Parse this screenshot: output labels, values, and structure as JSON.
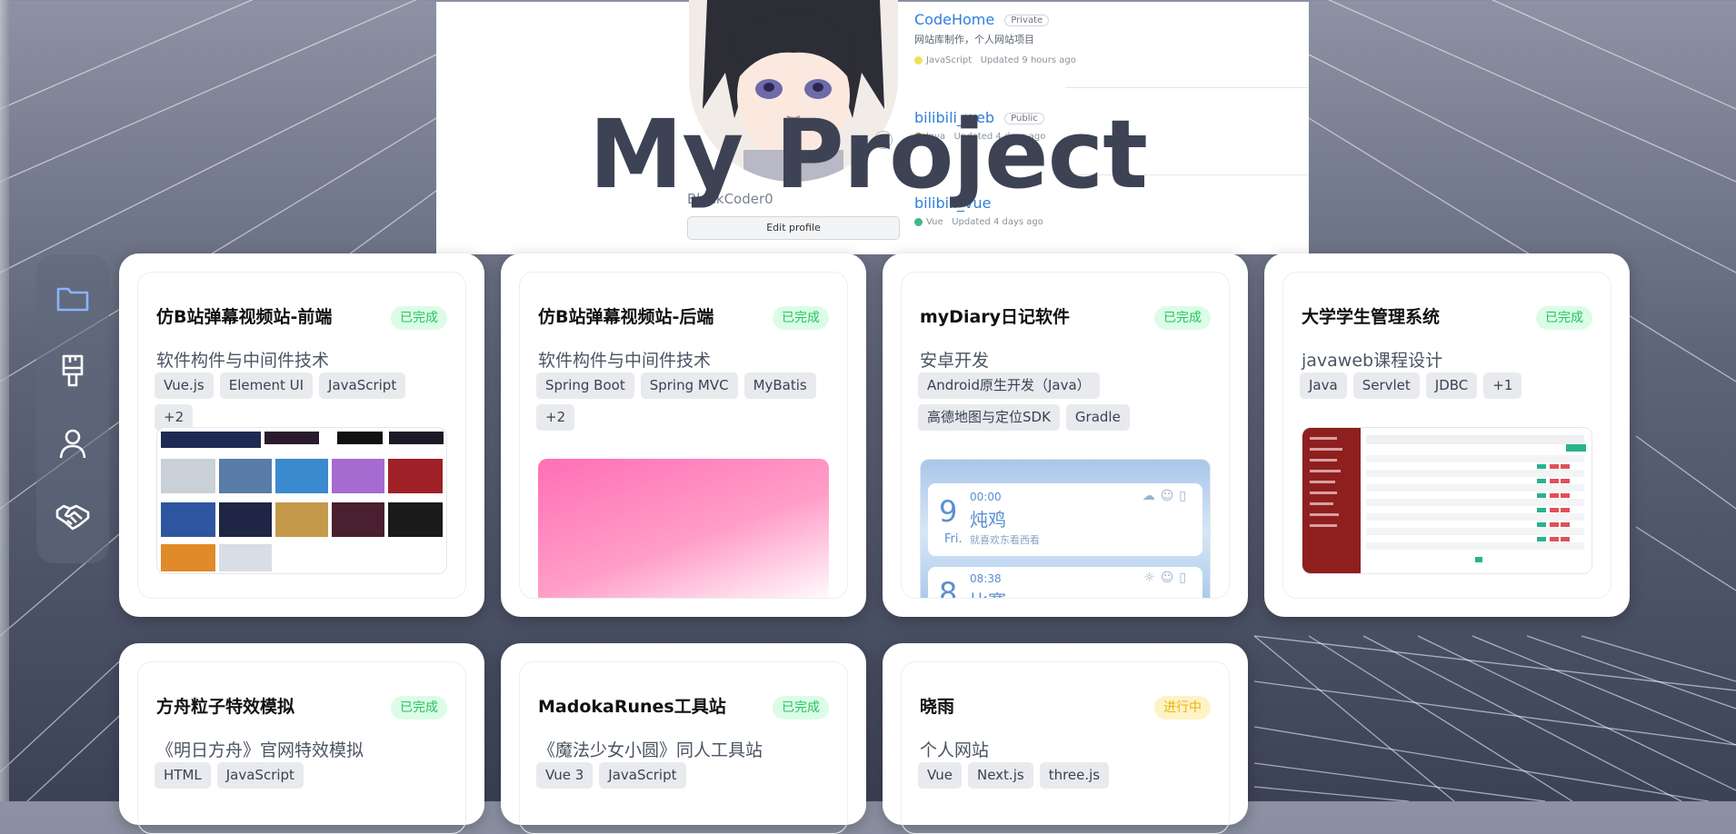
{
  "hero": {
    "title": "My Project",
    "profile_name": "BlackCoder0",
    "edit_profile_label": "Edit profile",
    "repos": [
      {
        "name": "CodeHome",
        "visibility": "Private",
        "description": "网站库制作，个人网站项目",
        "language": "JavaScript",
        "language_color": "#f1e05a",
        "updated": "Updated 9 hours ago"
      },
      {
        "name": "bilibili_web",
        "visibility": "Public",
        "description": "",
        "language": "Java",
        "language_color": "#b07219",
        "updated": "Updated 4 days ago"
      },
      {
        "name": "bilibili_vue",
        "visibility": "",
        "description": "",
        "language": "Vue",
        "language_color": "#41b883",
        "updated": "Updated 4 days ago"
      }
    ]
  },
  "sidebar": {
    "items": [
      {
        "name": "folder-icon",
        "color": "#8ab4ff"
      },
      {
        "name": "brush-icon",
        "color": "#ffffff"
      },
      {
        "name": "user-icon",
        "color": "#ffffff"
      },
      {
        "name": "handshake-icon",
        "color": "#ffffff"
      }
    ]
  },
  "projects": [
    {
      "title": "仿B站弹幕视频站-前端",
      "status": "已完成",
      "subtitle": "软件构件与中间件技术",
      "tags": [
        "Vue.js",
        "Element UI",
        "JavaScript",
        "+2"
      ],
      "preview": "video-grid"
    },
    {
      "title": "仿B站弹幕视频站-后端",
      "status": "已完成",
      "subtitle": "软件构件与中间件技术",
      "tags": [
        "Spring Boot",
        "Spring MVC",
        "MyBatis",
        "+2"
      ],
      "preview": "pink-gradient"
    },
    {
      "title": "myDiary日记软件",
      "status": "已完成",
      "subtitle": "安卓开发",
      "tags": [
        "Android原生开发（Java）",
        "高德地图与定位SDK",
        "Gradle"
      ],
      "preview": "diary",
      "diary": [
        {
          "day": "9",
          "weekday": "Fri.",
          "time": "00:00",
          "title": "炖鸡",
          "text": "就喜欢东看西看"
        },
        {
          "day": "8",
          "weekday": "",
          "time": "08:38",
          "title": "比赛",
          "text": ""
        }
      ]
    },
    {
      "title": "大学学生管理系统",
      "status": "已完成",
      "subtitle": "javaweb课程设计",
      "tags": [
        "Java",
        "Servlet",
        "JDBC",
        "+1"
      ],
      "preview": "admin"
    },
    {
      "title": "方舟粒子特效模拟",
      "status": "已完成",
      "subtitle": "《明日方舟》官网特效模拟",
      "tags": [
        "HTML",
        "JavaScript"
      ],
      "preview": "none"
    },
    {
      "title": "MadokaRunes工具站",
      "status": "已完成",
      "subtitle": "《魔法少女小圆》同人工具站",
      "tags": [
        "Vue 3",
        "JavaScript"
      ],
      "preview": "none"
    },
    {
      "title": "晓雨",
      "status": "进行中",
      "subtitle": "个人网站",
      "tags": [
        "Vue",
        "Next.js",
        "three.js"
      ],
      "preview": "none"
    }
  ],
  "colors": {
    "status_done_bg": "#dcfce7",
    "status_done_text": "#22c55e",
    "status_progress_bg": "#fef3c7",
    "status_progress_text": "#eab308"
  }
}
